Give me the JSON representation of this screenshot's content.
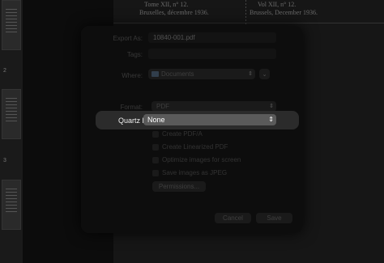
{
  "background": {
    "page_numbers": [
      "2",
      "3"
    ],
    "doc_left_title": "Tome XII, n° 12.",
    "doc_left_sub": "Bruxelles, décembre 1936.",
    "doc_right_title": "Vol XII, n° 12.",
    "doc_right_sub": "Brussels, December 1936."
  },
  "dialog": {
    "export_as_label": "Export As:",
    "export_as_value": "10840-001.pdf",
    "tags_label": "Tags:",
    "tags_value": "",
    "where_label": "Where:",
    "where_value": "Documents",
    "where_icon": "folder-icon",
    "format_label": "Format:",
    "format_value": "PDF",
    "quartz_label": "Quartz Filter:",
    "quartz_value": "None",
    "options": [
      {
        "label": "Create PDF/A",
        "checked": false
      },
      {
        "label": "Create Linearized PDF",
        "checked": false
      },
      {
        "label": "Optimize images for screen",
        "checked": false
      },
      {
        "label": "Save images as JPEG",
        "checked": false
      }
    ],
    "permissions_label": "Permissions...",
    "cancel_label": "Cancel",
    "save_label": "Save"
  }
}
